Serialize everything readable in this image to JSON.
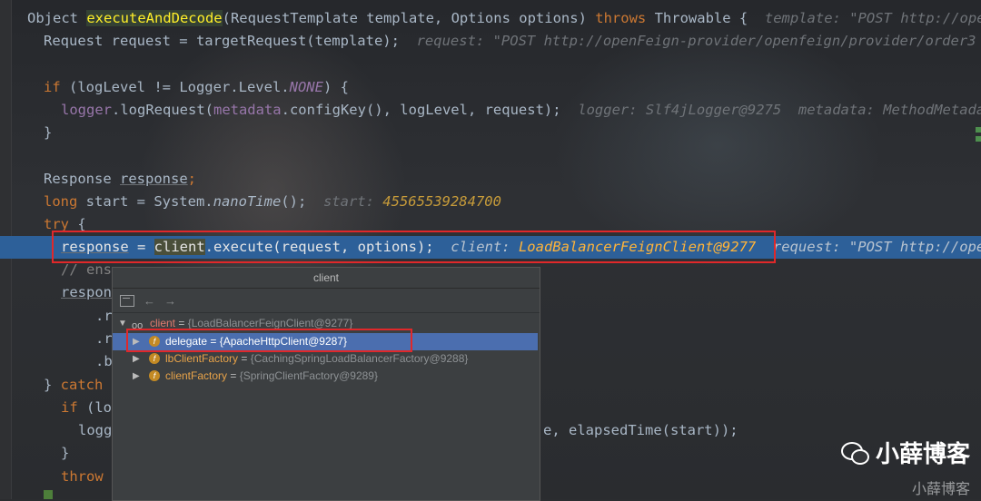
{
  "code": {
    "line1": {
      "pre": "Object ",
      "method": "executeAndDecode",
      "params": "(RequestTemplate template, Options options) ",
      "throws": "throws",
      "exc": " Throwable {",
      "hint": "  template: \"POST http://ope"
    },
    "line2": {
      "code": "Request request = targetRequest(template);",
      "hint": "  request: \"POST http://openFeign-provider/openfeign/provider/order3"
    },
    "line4": {
      "kw": "if",
      "a": " (logLevel != Logger.Level.",
      "const": "NONE",
      "b": ") {"
    },
    "line5": {
      "field": "logger",
      "a": ".logRequest(",
      "field2": "metadata",
      "b": ".configKey(), logLevel, request);",
      "hint": "  logger: Slf4jLogger@9275  metadata: MethodMetada"
    },
    "line6": {
      "code": "}"
    },
    "line8": {
      "a": "Response ",
      "var": "response",
      "b": ";"
    },
    "line9": {
      "kw": "long",
      "a": " start = System.",
      "m": "nanoTime",
      "b": "();",
      "hint_label": "  start: ",
      "hint_val": "45565539284700"
    },
    "line10": {
      "kw": "try",
      "a": " {"
    },
    "line11": {
      "var": "response",
      "a": " = ",
      "client": "client",
      "b": ".execute(request, options);",
      "hint_label": "  client: ",
      "hint_val": "LoadBalancerFeignClient@9277",
      "hint2": "  request: \"POST http://ope"
    },
    "line12": {
      "comment": "// ens"
    },
    "line13": {
      "code": "respon"
    },
    "line14": {
      "code": ".r"
    },
    "line15": {
      "code": ".r"
    },
    "line16": {
      "code": ".b"
    },
    "line17": {
      "a": "} ",
      "kw": "catch"
    },
    "line18": {
      "kw": "if",
      "a": " (lo"
    },
    "line19": {
      "a": "logg",
      "tail": "e, elapsedTime(start));"
    },
    "line20": {
      "code": "}"
    },
    "line21": {
      "kw": "throw"
    },
    "line22": {
      "code": "}"
    }
  },
  "popup": {
    "title": "client",
    "toolbar": {
      "back": "←",
      "forward": "→"
    },
    "root": {
      "name": "client",
      "eq": " = ",
      "value": "{LoadBalancerFeignClient@9277}"
    },
    "children": [
      {
        "badge": "f",
        "name": "delegate",
        "eq": " = ",
        "value": "{ApacheHttpClient@9287}",
        "selected": true
      },
      {
        "badge": "f",
        "name": "lbClientFactory",
        "eq": " = ",
        "value": "{CachingSpringLoadBalancerFactory@9288}"
      },
      {
        "badge": "f",
        "name": "clientFactory",
        "eq": " = ",
        "value": "{SpringClientFactory@9289}"
      }
    ]
  },
  "watermark": {
    "main": "小薛博客",
    "sub": "小薛博客"
  },
  "colors": {
    "accent": "#2d6099",
    "highlight_box": "#e0282a",
    "selection": "#4b6eaf"
  }
}
